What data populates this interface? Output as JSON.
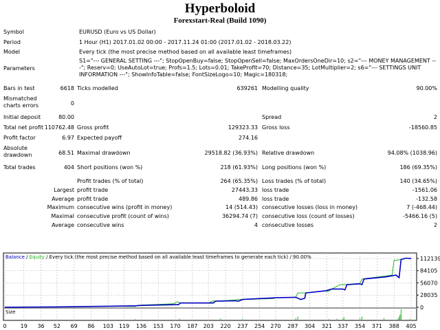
{
  "header": {
    "title": "Hyperboloid",
    "subtitle": "Forexstart-Real (Build 1090)"
  },
  "info": {
    "symbol_label": "Symbol",
    "symbol": "EURUSD (Euro vs US Dollar)",
    "period_label": "Period",
    "period": "1 Hour (H1) 2017.01.02 00:00 - 2017.11.24 01:00 (2017.01.02 - 2018.03.22)",
    "model_label": "Model",
    "model": "Every tick (the most precise method based on all available least timeframes)",
    "parameters_label": "Parameters",
    "parameters": "S1=\"--- GENERAL SETTING ---\"; StopOpenBuy=false; StopOpenSell=false; MaxOrdersOneDir=10; s2=\"--- MONEY MANAGEMENT ---\"; Reserv=0; UseAutoLot=true; Profs=1.5; Lots=0.01; TakeProfit=70; Distance=35; LotMultiplier=2; s6=\"--- SETTINGS UNIT INFORMATION ---\"; ShowInfoTable=false; FontSizeLogo=10; Magic=180318;"
  },
  "stats": {
    "bars_label": "Bars in test",
    "bars": "6618",
    "ticks_label": "Ticks modelled",
    "ticks": "639261",
    "quality_label": "Modelling quality",
    "quality": "90.00%",
    "mismatch_label1": "Mismatched",
    "mismatch_label2": "charts errors",
    "mismatch": "0",
    "deposit_label": "Initial deposit",
    "deposit": "80.00",
    "spread_label": "Spread",
    "spread": "2",
    "net_label": "Total net profit",
    "net": "110762.48",
    "gross_profit_label": "Gross profit",
    "gross_profit": "129323.33",
    "gross_loss_label": "Gross loss",
    "gross_loss": "-18560.85",
    "pf_label": "Profit factor",
    "pf": "6.97",
    "payoff_label": "Expected payoff",
    "payoff": "274.16",
    "abs_dd_label1": "Absolute",
    "abs_dd_label2": "drawdown",
    "abs_dd": "68.51",
    "max_dd_label": "Maximal drawdown",
    "max_dd": "29518.82 (36.93%)",
    "rel_dd_label": "Relative drawdown",
    "rel_dd": "94.08% (1038.96)",
    "trades_label": "Total trades",
    "trades": "404",
    "short_label": "Short positions (won %)",
    "short": "218 (61.93%)",
    "long_label": "Long positions (won %)",
    "long": "186 (69.35%)",
    "profit_trades_label": "Profit trades (% of total)",
    "profit_trades": "264 (65.35%)",
    "loss_trades_label": "Loss trades (% of total)",
    "loss_trades": "140 (34.65%)",
    "largest": "Largest",
    "largest_profit_label": "profit trade",
    "largest_profit": "27443.33",
    "largest_loss_label": "loss trade",
    "largest_loss": "-1561.06",
    "average": "Average",
    "avg_profit_label": "profit trade",
    "avg_profit": "489.86",
    "avg_loss_label": "loss trade",
    "avg_loss": "-132.58",
    "maximum": "Maximum",
    "max_wins_label": "consecutive wins (profit in money)",
    "max_wins": "14 (514.43)",
    "max_losses_label": "consecutive losses (loss in money)",
    "max_losses": "7 (-468.44)",
    "maximal": "Maximal",
    "maximal_profit_label": "consecutive profit (count of wins)",
    "maximal_profit": "36294.74 (7)",
    "maximal_loss_label": "consecutive loss (count of losses)",
    "maximal_loss": "-5466.16 (5)",
    "average2": "Average",
    "avg_wins_label": "consecutive wins",
    "avg_wins": "4",
    "avg_losses_label": "consecutive losses",
    "avg_losses": "2"
  },
  "chart_data": {
    "type": "line",
    "title_parts": {
      "balance": "Balance",
      "sep1": " / ",
      "equity": "Equity",
      "rest": " / Every tick (the most precise method based on all available least timeframes to generate each tick) / 90.00%"
    },
    "colors": {
      "balance": "#0000c0",
      "equity": "#22b422"
    },
    "x_ticks": [
      0,
      19,
      36,
      52,
      69,
      86,
      103,
      119,
      136,
      153,
      170,
      187,
      203,
      220,
      237,
      254,
      270,
      287,
      304,
      321,
      337,
      354,
      371,
      388,
      405
    ],
    "y_ticks": [
      0,
      28035,
      56070,
      84105,
      112139
    ],
    "xlim": [
      0,
      405
    ],
    "ylim": [
      0,
      112139
    ],
    "grid": true,
    "size_label": "Size",
    "series": [
      {
        "name": "Balance",
        "x": [
          0,
          52,
          103,
          130,
          136,
          170,
          173,
          175,
          203,
          208,
          210,
          230,
          233,
          237,
          270,
          290,
          295,
          299,
          300,
          320,
          326,
          337,
          339,
          341,
          354,
          356,
          358,
          380,
          385,
          390,
          393,
          395,
          400,
          405
        ],
        "values": [
          80,
          1000,
          2500,
          3500,
          4500,
          6000,
          6000,
          10000,
          10000,
          10000,
          14000,
          15000,
          14000,
          18000,
          22000,
          23000,
          18000,
          21000,
          33000,
          38000,
          42000,
          42000,
          40000,
          52000,
          54000,
          52000,
          65000,
          70000,
          72000,
          74000,
          68000,
          110000,
          113000,
          112000
        ]
      },
      {
        "name": "Equity",
        "x": [
          0,
          52,
          103,
          130,
          132,
          136,
          168,
          172,
          175,
          203,
          208,
          210,
          230,
          232,
          237,
          268,
          270,
          290,
          292,
          300,
          320,
          322,
          326,
          334,
          337,
          354,
          356,
          380,
          386,
          388,
          390,
          395,
          400,
          405
        ],
        "values": [
          80,
          1000,
          2500,
          2000,
          4500,
          5000,
          8000,
          13000,
          10000,
          10000,
          15000,
          14000,
          17000,
          18000,
          18000,
          20000,
          22000,
          23000,
          33000,
          33000,
          38000,
          36000,
          42000,
          52000,
          52000,
          55000,
          65000,
          72000,
          74000,
          108000,
          108000,
          110000,
          113000,
          112000
        ]
      }
    ],
    "size_bars": {
      "x": [
        130,
        174,
        215,
        237,
        270,
        290,
        292,
        323,
        331,
        337,
        338,
        354,
        356,
        378,
        392,
        393,
        394,
        395,
        404
      ],
      "values": [
        0.05,
        0.1,
        0.1,
        0.1,
        0.05,
        0.15,
        0.3,
        0.05,
        0.1,
        0.1,
        0.25,
        0.15,
        0.3,
        0.15,
        0.1,
        0.3,
        0.5,
        1.0,
        0.05
      ]
    }
  }
}
